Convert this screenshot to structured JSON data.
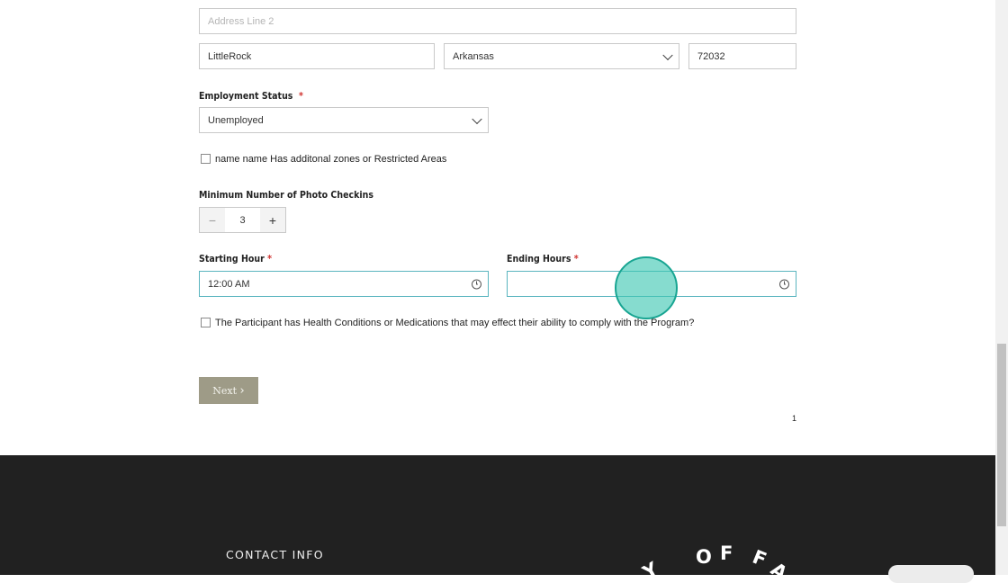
{
  "address": {
    "line2_placeholder": "Address Line 2",
    "city": "LittleRock",
    "state": "Arkansas",
    "zip": "72032"
  },
  "employment": {
    "label": "Employment Status",
    "required_mark": "*",
    "value": "Unemployed"
  },
  "zones_checkbox": {
    "label": "name name Has additonal zones or Restricted Areas",
    "checked": false
  },
  "photo_checkins": {
    "label": "Minimum Number of Photo Checkins",
    "value": "3",
    "minus": "−",
    "plus": "+"
  },
  "starting_hour": {
    "label": "Starting Hour",
    "required_mark": "*",
    "value": "12:00 AM"
  },
  "ending_hours": {
    "label": "Ending Hours",
    "required_mark": "*",
    "value": ""
  },
  "health_checkbox": {
    "label": "The Participant has Health Conditions or Medications that may effect their ability to comply with the Program?",
    "checked": false
  },
  "next_button": {
    "label": "Next",
    "arrow": "›"
  },
  "page_number": "1",
  "footer": {
    "contact_heading": "CONTACT INFO",
    "logo_text": "Y O F F A"
  },
  "colors": {
    "accent_focus": "#5ab5bf",
    "required": "#d0322f",
    "next_button": "#9e9b87",
    "footer_bg": "#212121",
    "touch_indicator": "#3cc6b2"
  },
  "icons": [
    "chevron-down-icon",
    "clock-icon",
    "minus-icon",
    "plus-icon",
    "chevron-right-icon"
  ]
}
